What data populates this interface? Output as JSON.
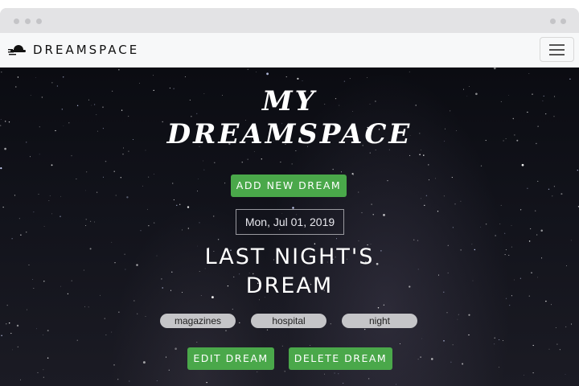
{
  "navbar": {
    "brand": "DREAMSPACE",
    "brand_icon": "flying-saucer-icon",
    "menu_icon": "hamburger-menu-icon"
  },
  "hero": {
    "title_line1": "MY",
    "title_line2": "DREAMSPACE",
    "add_button": "ADD NEW DREAM"
  },
  "dream": {
    "date": "Mon, Jul 01, 2019",
    "title_line1": "LAST NIGHT'S",
    "title_line2": "DREAM",
    "tags": [
      "magazines",
      "hospital",
      "night"
    ],
    "edit_button": "EDIT DREAM",
    "delete_button": "DELETE DREAM"
  },
  "colors": {
    "accent_green": "#4aa84a",
    "tag_gray": "#c5c5c8",
    "sky": "#0b0c12"
  }
}
